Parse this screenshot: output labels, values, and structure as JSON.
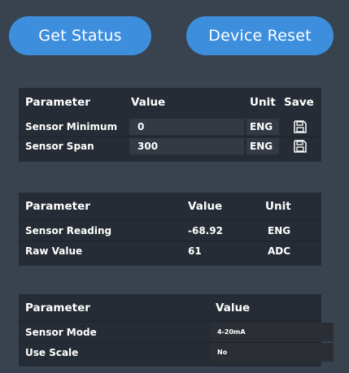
{
  "buttons": {
    "get_status": "Get Status",
    "device_reset": "Device Reset"
  },
  "config_table": {
    "headers": {
      "parameter": "Parameter",
      "value": "Value",
      "unit": "Unit",
      "save": "Save"
    },
    "rows": [
      {
        "parameter": "Sensor Minimum",
        "value": "0",
        "unit": "ENG"
      },
      {
        "parameter": "Sensor Span",
        "value": "300",
        "unit": "ENG"
      }
    ]
  },
  "reading_table": {
    "headers": {
      "parameter": "Parameter",
      "value": "Value",
      "unit": "Unit"
    },
    "rows": [
      {
        "parameter": "Sensor Reading",
        "value": "-68.92",
        "unit": "ENG"
      },
      {
        "parameter": "Raw Value",
        "value": "61",
        "unit": "ADC"
      }
    ]
  },
  "mode_table": {
    "headers": {
      "parameter": "Parameter",
      "value": "Value"
    },
    "rows": [
      {
        "parameter": "Sensor Mode",
        "value": "4-20mA"
      },
      {
        "parameter": "Use Scale",
        "value": "No"
      }
    ]
  },
  "icons": {
    "save": "floppy-disk-icon"
  },
  "colors": {
    "background": "#394350",
    "panel": "#262c35",
    "button": "#3d8fde"
  }
}
